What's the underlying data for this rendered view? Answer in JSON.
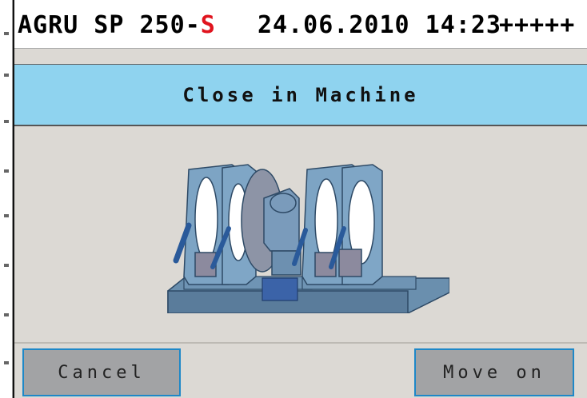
{
  "header": {
    "model": "AGRU SP 250",
    "model_dash": "-",
    "model_suffix": "S",
    "datetime": "24.06.2010 14:23",
    "signal": "+++++"
  },
  "title": "Close in Machine",
  "illustration": {
    "icon": "butt-fusion-machine-icon"
  },
  "buttons": {
    "cancel": "Cancel",
    "move_on": "Move on"
  },
  "colors": {
    "title_bar": "#8fd3ef",
    "model_suffix": "#e0141e",
    "button_border": "#1e88c8",
    "button_fill": "#a2a3a5",
    "machine_fill": "#6a8fae"
  }
}
